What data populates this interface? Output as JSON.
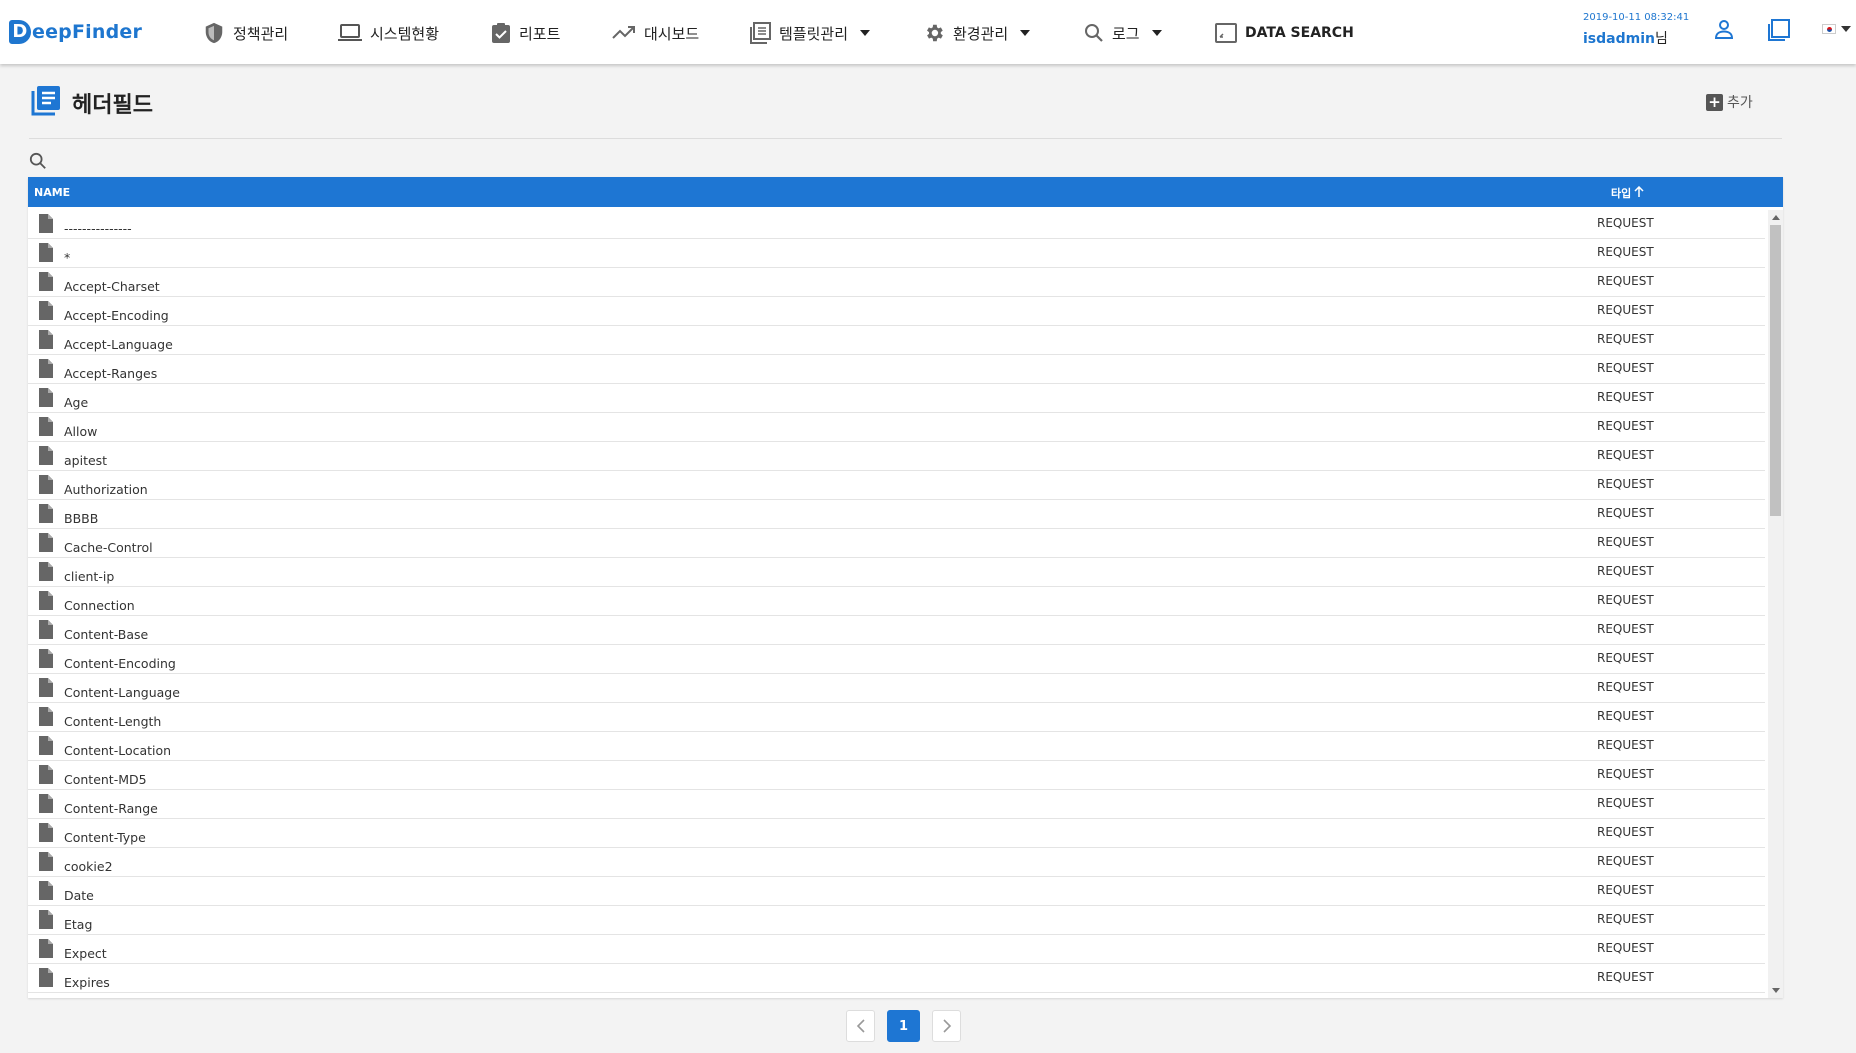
{
  "brand": {
    "logo_letter": "D",
    "logo_rest": "eepFinder",
    "accent": "#1e76d3"
  },
  "nav": [
    {
      "label": "정책관리",
      "icon": "shield-icon",
      "dropdown": false
    },
    {
      "label": "시스템현황",
      "icon": "laptop-icon",
      "dropdown": false
    },
    {
      "label": "리포트",
      "icon": "clipboard-check-icon",
      "dropdown": false
    },
    {
      "label": "대시보드",
      "icon": "trend-icon",
      "dropdown": false
    },
    {
      "label": "템플릿관리",
      "icon": "template-icon",
      "dropdown": true
    },
    {
      "label": "환경관리",
      "icon": "gear-icon",
      "dropdown": true
    },
    {
      "label": "로그",
      "icon": "search-icon",
      "dropdown": true
    },
    {
      "label": "DATA SEARCH",
      "icon": "data-search-icon",
      "dropdown": false
    }
  ],
  "header_right": {
    "datetime": "2019-10-11 08:32:41",
    "username": "isdadmin",
    "user_suffix": "님",
    "language": "ko",
    "icons": [
      "user-icon",
      "window-icon",
      "korea-flag-icon"
    ]
  },
  "page": {
    "title": "헤더필드",
    "title_icon": "list-document-icon",
    "add_label": "추가"
  },
  "search": {
    "placeholder": "",
    "value": ""
  },
  "table": {
    "columns": {
      "name": "NAME",
      "type": "타입"
    },
    "sort": {
      "column": "타입",
      "direction": "asc"
    },
    "rows": [
      {
        "name": "---------------",
        "type": "REQUEST"
      },
      {
        "name": "*",
        "type": "REQUEST"
      },
      {
        "name": "Accept-Charset",
        "type": "REQUEST"
      },
      {
        "name": "Accept-Encoding",
        "type": "REQUEST"
      },
      {
        "name": "Accept-Language",
        "type": "REQUEST"
      },
      {
        "name": "Accept-Ranges",
        "type": "REQUEST"
      },
      {
        "name": "Age",
        "type": "REQUEST"
      },
      {
        "name": "Allow",
        "type": "REQUEST"
      },
      {
        "name": "apitest",
        "type": "REQUEST"
      },
      {
        "name": "Authorization",
        "type": "REQUEST"
      },
      {
        "name": "BBBB",
        "type": "REQUEST"
      },
      {
        "name": "Cache-Control",
        "type": "REQUEST"
      },
      {
        "name": "client-ip",
        "type": "REQUEST"
      },
      {
        "name": "Connection",
        "type": "REQUEST"
      },
      {
        "name": "Content-Base",
        "type": "REQUEST"
      },
      {
        "name": "Content-Encoding",
        "type": "REQUEST"
      },
      {
        "name": "Content-Language",
        "type": "REQUEST"
      },
      {
        "name": "Content-Length",
        "type": "REQUEST"
      },
      {
        "name": "Content-Location",
        "type": "REQUEST"
      },
      {
        "name": "Content-MD5",
        "type": "REQUEST"
      },
      {
        "name": "Content-Range",
        "type": "REQUEST"
      },
      {
        "name": "Content-Type",
        "type": "REQUEST"
      },
      {
        "name": "cookie2",
        "type": "REQUEST"
      },
      {
        "name": "Date",
        "type": "REQUEST"
      },
      {
        "name": "Etag",
        "type": "REQUEST"
      },
      {
        "name": "Expect",
        "type": "REQUEST"
      },
      {
        "name": "Expires",
        "type": "REQUEST"
      }
    ]
  },
  "pagination": {
    "current": "1"
  }
}
